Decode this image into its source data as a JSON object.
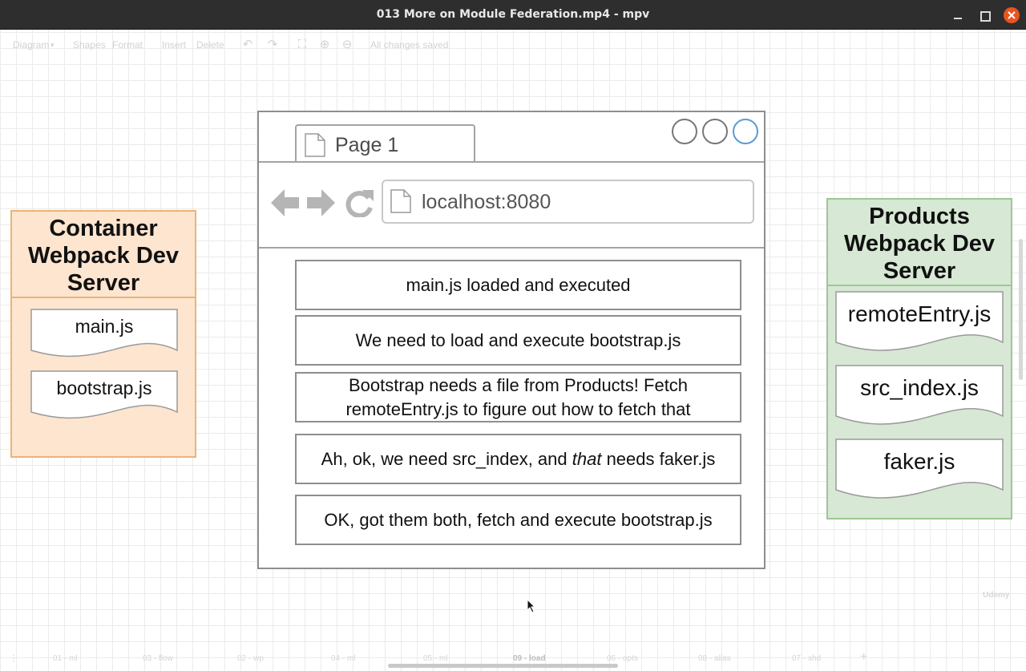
{
  "window": {
    "title": "013 More on Module Federation.mp4 - mpv"
  },
  "toolbar": {
    "diagram_menu": "Diagram",
    "shapes": "Shapes",
    "format": "Format",
    "insert": "Insert",
    "delete": "Delete",
    "status": "All changes saved"
  },
  "container_server": {
    "title_line1": "Container",
    "title_line2": "Webpack Dev",
    "title_line3": "Server",
    "files": [
      "main.js",
      "bootstrap.js"
    ],
    "fill_color": "#fde5cf",
    "border_color": "#e9b577"
  },
  "browser": {
    "tab_label": "Page 1",
    "url": "localhost:8080",
    "steps": [
      "main.js loaded and executed",
      "We need to load and execute bootstrap.js",
      "Bootstrap needs a file from Products! Fetch remoteEntry.js to figure out how to fetch that",
      "OK, got them both, fetch and execute bootstrap.js"
    ],
    "step4": {
      "before": "Ah, ok, we need src_index, and ",
      "emph": "that",
      "after": " needs faker.js"
    }
  },
  "products_server": {
    "title_line1": "Products",
    "title_line2": "Webpack Dev",
    "title_line3": "Server",
    "files": [
      "remoteEntry.js",
      "src_index.js",
      "faker.js"
    ],
    "fill_color": "#d7e8d4",
    "border_color": "#9cc893"
  },
  "bottom_tabs": [
    "01 - ml",
    "03 - flow",
    "02 - wp",
    "04 - ml",
    "05 - ml",
    "09 - load",
    "06 - opts",
    "08 - alias",
    "07 - shd"
  ],
  "watermark": "Udemy"
}
